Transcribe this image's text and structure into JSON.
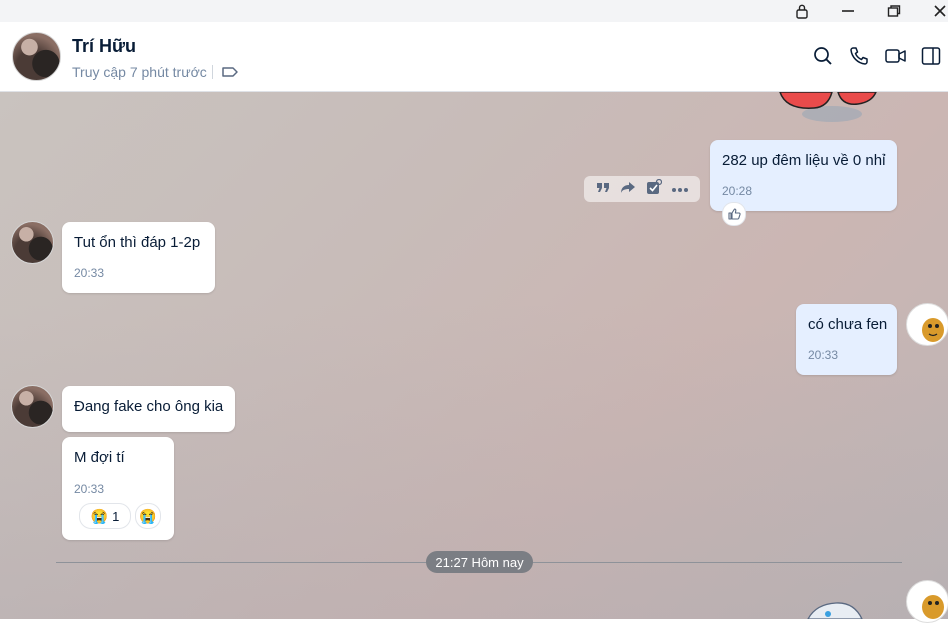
{
  "window": {
    "controls": [
      "lock-icon",
      "minimize-icon",
      "restore-icon",
      "close-icon"
    ]
  },
  "header": {
    "contact_name": "Trí Hữu",
    "status": "Truy cập 7 phút trước",
    "icons": [
      "tag-icon",
      "search-icon",
      "phone-icon",
      "video-call-icon",
      "sidebar-toggle-icon"
    ]
  },
  "messages": [
    {
      "id": "m1",
      "direction": "out",
      "text": "282 up đêm liệu về 0 nhỉ",
      "time": "20:28"
    },
    {
      "id": "m2",
      "direction": "in",
      "text": "Tut ổn thì đáp 1-2p",
      "time": "20:33"
    },
    {
      "id": "m3",
      "direction": "out",
      "text": "có chưa fen",
      "time": "20:33"
    },
    {
      "id": "m4",
      "direction": "in",
      "text": "Đang fake cho ông kia",
      "time": ""
    },
    {
      "id": "m5",
      "direction": "in",
      "text": "M đợi tí",
      "time": "20:33",
      "reaction_emoji": "😭",
      "reaction_count": "1"
    }
  ],
  "message_actions": [
    "quote-icon",
    "forward-icon",
    "select-icon",
    "more-icon"
  ],
  "day_divider": "21:27 Hôm nay",
  "colors": {
    "incoming_bubble": "#ffffff",
    "outgoing_bubble": "#e5efff",
    "accent": "#0068ff",
    "divider_pill": "#7b7e84"
  }
}
